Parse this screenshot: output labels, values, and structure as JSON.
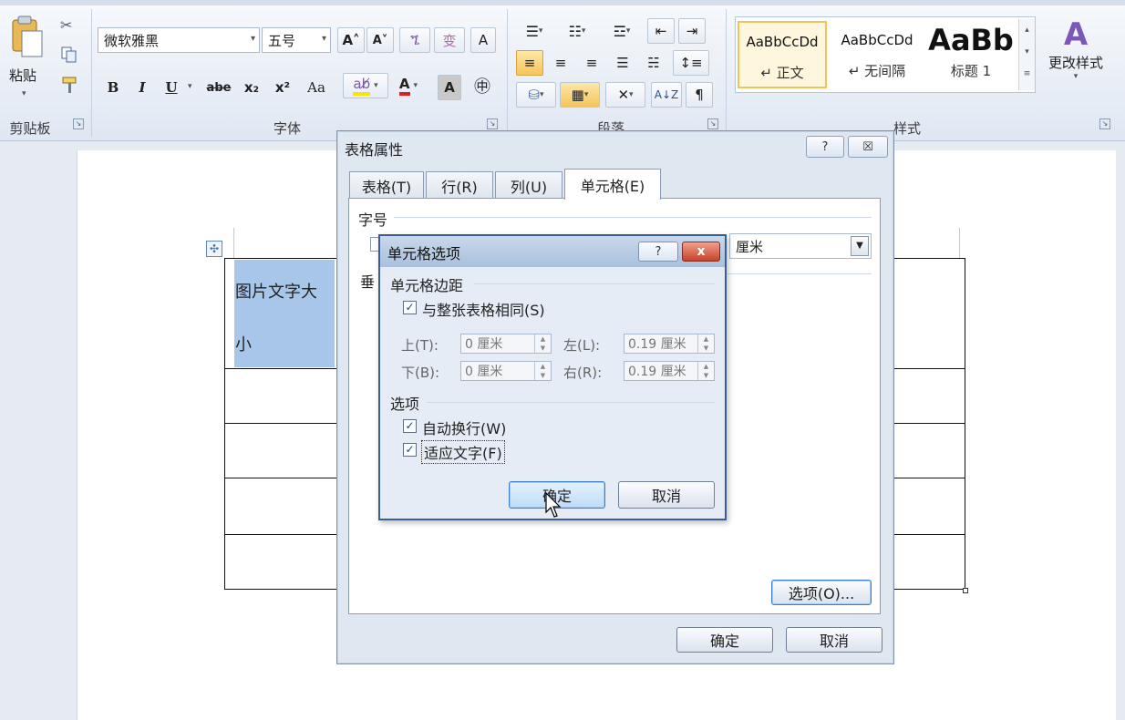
{
  "ribbon": {
    "clipboard": {
      "paste": "粘贴",
      "group": "剪贴板"
    },
    "font": {
      "family": "微软雅黑",
      "size": "五号",
      "group": "字体",
      "bold": "B",
      "italic": "I",
      "underline": "U",
      "strike": "abe",
      "subscript": "x₂",
      "superscript": "x²",
      "change_case": "Aa",
      "grow": "A˄",
      "shrink": "A˅",
      "phonetic": "ጜ",
      "clear": "变",
      "border_char": "A",
      "font_color": "A",
      "char_shade": "A",
      "enclose": "㊥"
    },
    "paragraph": {
      "group": "段落"
    },
    "styles": {
      "group": "样式",
      "items": [
        {
          "sample": "AaBbCcDd",
          "name": "↵ 正文"
        },
        {
          "sample": "AaBbCcDd",
          "name": "↵ 无间隔"
        },
        {
          "sample": "AaBb",
          "name": "标题 1"
        }
      ],
      "change_styles": "更改样式"
    }
  },
  "document": {
    "cell_text_1": "图片文字大",
    "cell_text_2": "小"
  },
  "table_props": {
    "title": "表格属性",
    "help": "?",
    "close": "☒",
    "tabs": [
      "表格(T)",
      "行(R)",
      "列(U)",
      "单元格(E)"
    ],
    "section_size": "字号",
    "unit": "厘米",
    "vertical_prefix": "垂",
    "options_button": "选项(O)...",
    "ok": "确定",
    "cancel": "取消"
  },
  "cell_options": {
    "title": "单元格选项",
    "help": "?",
    "close": "x",
    "margins_section": "单元格边距",
    "same_as_table": "与整张表格相同(S)",
    "top_label": "上(T):",
    "top_value": "0 厘米",
    "left_label": "左(L):",
    "left_value": "0.19 厘米",
    "bottom_label": "下(B):",
    "bottom_value": "0 厘米",
    "right_label": "右(R):",
    "right_value": "0.19 厘米",
    "options_section": "选项",
    "wrap_text": "自动换行(W)",
    "fit_text": "适应文字(F)",
    "ok": "确定",
    "cancel": "取消"
  },
  "colors": {
    "highlight_cell": "#a7c6ea",
    "close_red": "#c8432b",
    "focus_blue": "#3c7fd0"
  }
}
